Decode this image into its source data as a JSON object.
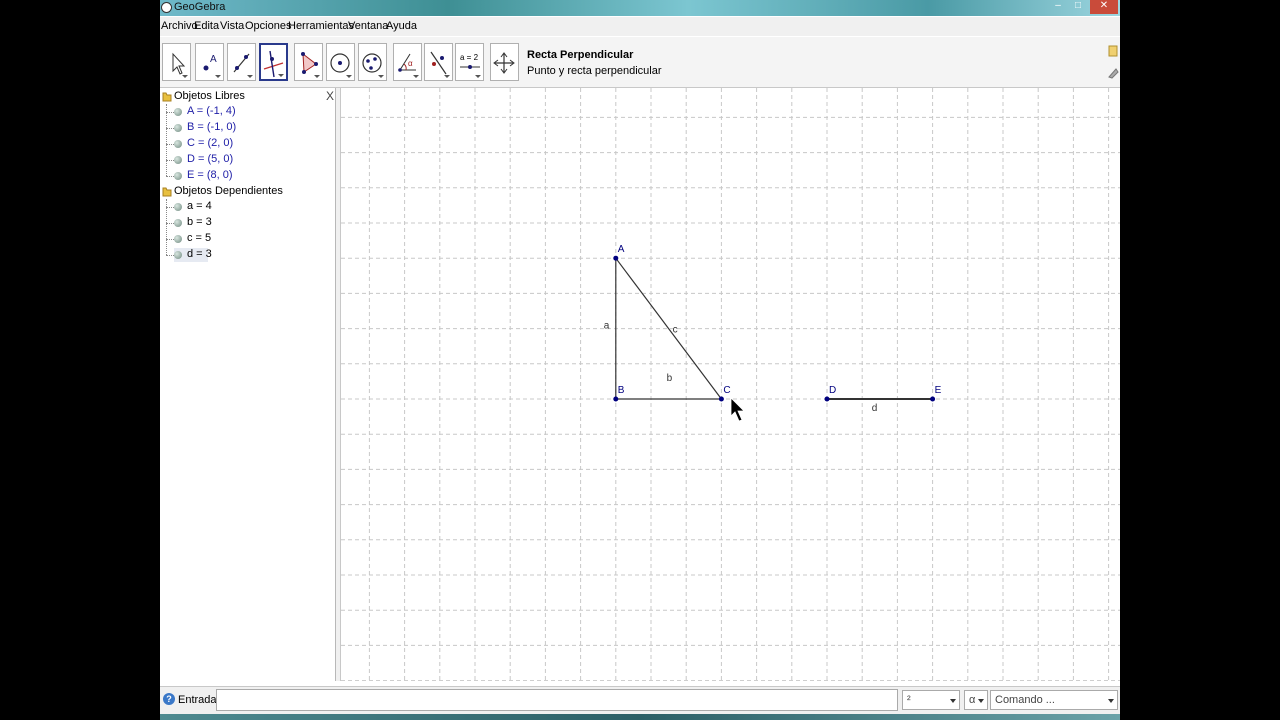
{
  "window": {
    "title": "GeoGebra"
  },
  "menu": [
    "Archivo",
    "Edita",
    "Vista",
    "Opciones",
    "Herramientas",
    "Ventana",
    "Ayuda"
  ],
  "toolbar": {
    "active_tool_name": "Recta Perpendicular",
    "active_tool_description": "Punto y recta perpendicular",
    "tools": [
      "move",
      "point",
      "line",
      "perpendicular-line",
      "polygon",
      "circle",
      "conic",
      "angle",
      "reflect",
      "slider",
      "move-view"
    ],
    "slider_label": "a = 2"
  },
  "algebra": {
    "close_label": "X",
    "free_label": "Objetos Libres",
    "free": [
      "A = (-1, 4)",
      "B = (-1, 0)",
      "C = (2, 0)",
      "D = (5, 0)",
      "E = (8, 0)"
    ],
    "dependent_label": "Objetos Dependientes",
    "dependent": [
      "a = 4",
      "b = 3",
      "c = 5",
      "d = 3"
    ]
  },
  "graphics": {
    "points": [
      {
        "name": "A",
        "x": -1,
        "y": 4
      },
      {
        "name": "B",
        "x": -1,
        "y": 0
      },
      {
        "name": "C",
        "x": 2,
        "y": 0
      },
      {
        "name": "D",
        "x": 5,
        "y": 0
      },
      {
        "name": "E",
        "x": 8,
        "y": 0
      }
    ],
    "segments": [
      {
        "name": "a",
        "from": "A",
        "to": "B"
      },
      {
        "name": "b",
        "from": "B",
        "to": "C"
      },
      {
        "name": "c",
        "from": "A",
        "to": "C"
      },
      {
        "name": "d",
        "from": "D",
        "to": "E"
      }
    ],
    "point_color": "#00007f",
    "grid": true
  },
  "input": {
    "label": "Entrada:",
    "value": "",
    "symbol_combo": "²",
    "greek_combo": "α",
    "command_combo": "Comando ..."
  },
  "window_controls": [
    "–",
    "□",
    "✕"
  ]
}
